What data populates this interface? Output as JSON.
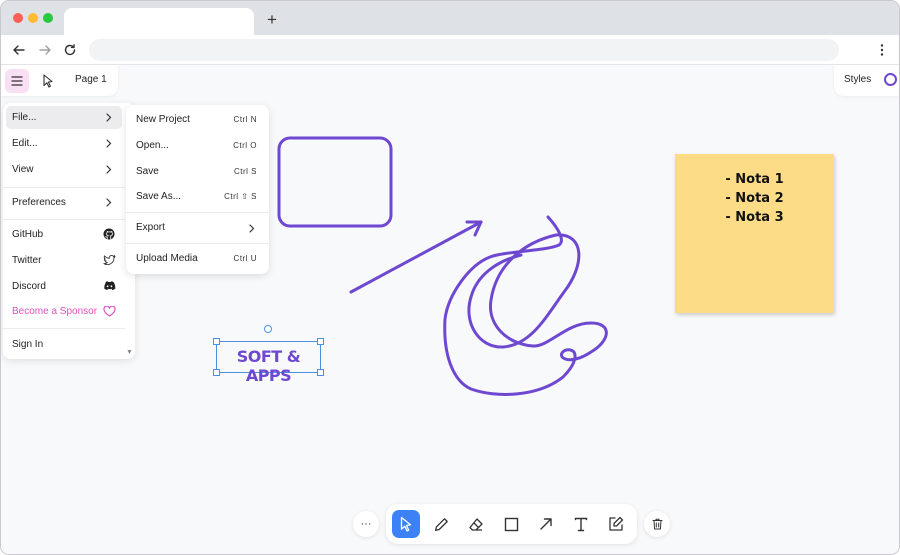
{
  "browser": {
    "tab_title": "",
    "new_tab": "+",
    "url": ""
  },
  "app": {
    "page_label": "Page 1",
    "styles_label": "Styles",
    "accent_color": "#6e48d1"
  },
  "main_menu": {
    "items": [
      {
        "label": "File..."
      },
      {
        "label": "Edit..."
      },
      {
        "label": "View"
      },
      {
        "label": "Preferences"
      },
      {
        "label": "GitHub"
      },
      {
        "label": "Twitter"
      },
      {
        "label": "Discord"
      },
      {
        "label": "Become a Sponsor"
      },
      {
        "label": "Sign In"
      }
    ]
  },
  "file_menu": {
    "items": [
      {
        "label": "New Project",
        "shortcut": "Ctrl N"
      },
      {
        "label": "Open...",
        "shortcut": "Ctrl O"
      },
      {
        "label": "Save",
        "shortcut": "Ctrl S"
      },
      {
        "label": "Save As...",
        "shortcut": "Ctrl ⇧ S"
      },
      {
        "label": "Export",
        "shortcut": ""
      },
      {
        "label": "Upload Media",
        "shortcut": "Ctrl U"
      }
    ]
  },
  "canvas": {
    "note_lines": [
      "- Nota 1",
      "- Nota 2",
      "- Nota 3"
    ],
    "note_color": "#fcdc86",
    "text_shape": "SOFT & APPS",
    "stroke_color": "#6e48d1"
  },
  "bottom_toolbar": {
    "more_label": "···",
    "tools": [
      "select-icon",
      "pencil-icon",
      "eraser-icon",
      "rectangle-icon",
      "arrow-icon",
      "text-icon",
      "sticky-note-icon"
    ],
    "active_tool": "select-icon",
    "active_color": "#3c82f6"
  }
}
